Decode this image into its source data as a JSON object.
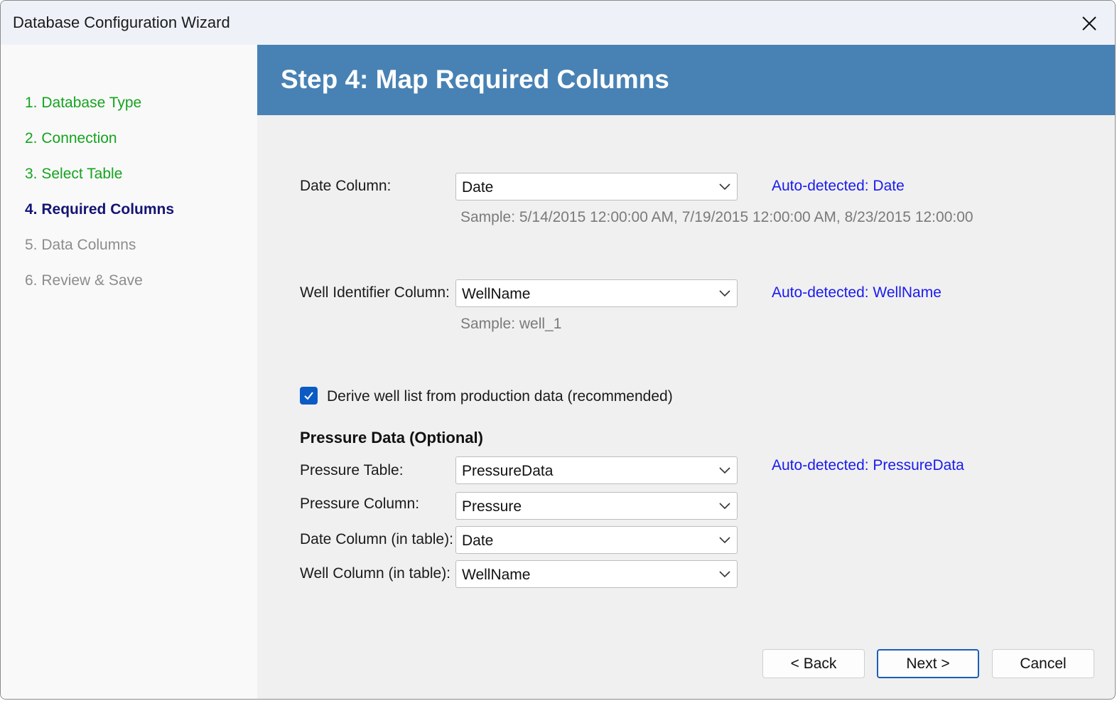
{
  "window": {
    "title": "Database Configuration Wizard"
  },
  "sidebar": {
    "steps": [
      {
        "label": "1. Database Type",
        "state": "done"
      },
      {
        "label": "2. Connection",
        "state": "done"
      },
      {
        "label": "3. Select Table",
        "state": "done"
      },
      {
        "label": "4. Required Columns",
        "state": "current"
      },
      {
        "label": "5. Data Columns",
        "state": "future"
      },
      {
        "label": "6. Review & Save",
        "state": "future"
      }
    ]
  },
  "header": {
    "title": "Step 4: Map Required Columns"
  },
  "date_column": {
    "label": "Date Column:",
    "value": "Date",
    "auto": "Auto-detected: Date",
    "sample": "Sample: 5/14/2015 12:00:00 AM, 7/19/2015 12:00:00 AM, 8/23/2015 12:00:00"
  },
  "well_column": {
    "label": "Well Identifier Column:",
    "value": "WellName",
    "auto": "Auto-detected: WellName",
    "sample": "Sample: well_1"
  },
  "derive_checkbox": {
    "label": "Derive well list from production data (recommended)",
    "checked": true
  },
  "pressure": {
    "section_title": "Pressure Data (Optional)",
    "table_label": "Pressure Table:",
    "table_value": "PressureData",
    "table_auto": "Auto-detected: PressureData",
    "column_label": "Pressure Column:",
    "column_value": "Pressure",
    "date_label": "Date Column (in table):",
    "date_value": "Date",
    "well_label": "Well Column (in table):",
    "well_value": "WellName"
  },
  "buttons": {
    "back": "< Back",
    "next": "Next >",
    "cancel": "Cancel"
  },
  "colors": {
    "header_bg": "#4882b4",
    "done_step": "#15a31f",
    "current_step": "#141475",
    "future_step": "#8c8c8c",
    "auto_detected": "#1a1aee",
    "checkbox": "#0a5bc4"
  }
}
